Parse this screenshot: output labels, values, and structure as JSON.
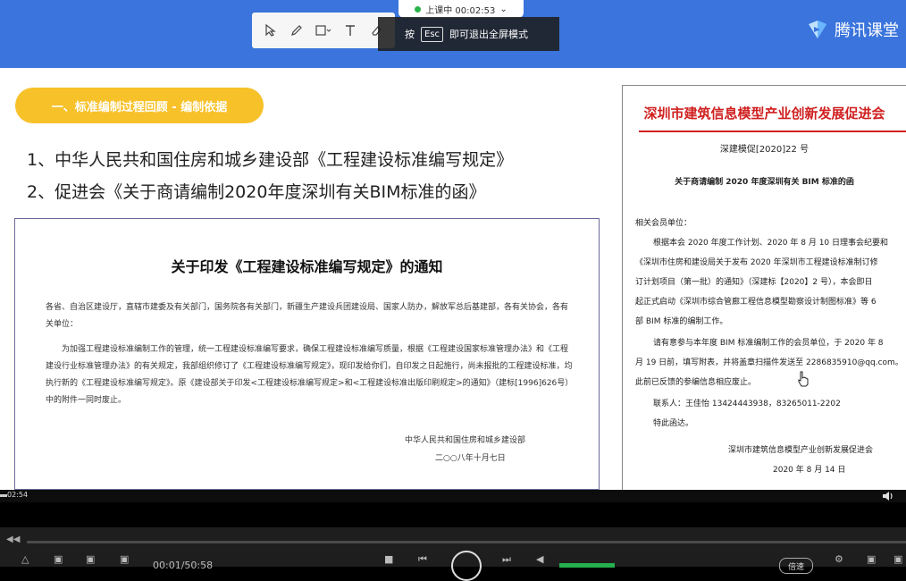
{
  "recording": {
    "status": "上课中 00:02:53",
    "dropdown": "⌄"
  },
  "esc_tip": {
    "prefix": "按",
    "key": "Esc",
    "suffix": "即可退出全屏模式"
  },
  "brand": {
    "name": "腾讯课堂"
  },
  "toolbar": {
    "tools": [
      "pointer-tool",
      "pen-tool",
      "shape-tool",
      "text-tool",
      "eraser-tool"
    ]
  },
  "slide": {
    "section_title": "一、标准编制过程回顾 - 编制依据",
    "basis": [
      "1、中华人民共和国住房和城乡建设部《工程建设标准编写规定》",
      "2、促进会《关于商请编制2020年度深圳有关BIM标准的函》"
    ],
    "doc1": {
      "title": "关于印发《工程建设标准编写规定》的通知",
      "p1": "各省、自治区建设厅，直辖市建委及有关部门，国务院各有关部门，新疆生产建设兵团建设局、国家人防办，解放军总后基建部，各有关协会，各有关单位：",
      "p2": "为加强工程建设标准编制工作的管理，统一工程建设标准编写要求，确保工程建设标准编写质量，根据《工程建设国家标准管理办法》和《工程建设行业标准管理办法》的有关规定，我部组织修订了《工程建设标准编写规定》，现印发给你们，自印发之日起施行，尚未报批的工程建设标准，均执行新的《工程建设标准编写规定》。原《建设部关于印发<工程建设标准编写规定>和<工程建设标准出版印刷规定>的通知》（建标[1996]626号）中的附件一同时废止。",
      "sign_org": "中华人民共和国住房和城乡建设部",
      "sign_date": "二○○八年十月七日"
    },
    "doc2": {
      "org": "深圳市建筑信息模型产业创新发展促进会",
      "ref": "深建模促[2020]22 号",
      "title": "关于商请编制 2020 年度深圳有关 BIM 标准的函",
      "salutation": "相关会员单位：",
      "lines": [
        "根据本会 2020 年度工作计划、2020 年 8 月 10 日理事会纪要和",
        "《深圳市住房和建设局关于发布 2020 年深圳市工程建设标准制订修",
        "订计划项目（第一批）的通知》（深建标【2020】2 号），本会即日",
        "起正式启动《深圳市综合管廊工程信息模型勘察设计制图标准》等 6",
        "部 BIM 标准的编制工作。",
        "请有意参与本年度 BIM 标准编制工作的会员单位，于 2020 年 8",
        "月 19 日前，填写附表，并将盖章扫描件发送至 2286835910@qq.com。",
        "此前已反馈的参编信息相应废止。",
        "联系人：王佳怡 13424443938，83265011-2202",
        "特此函达。"
      ],
      "sign_org": "深圳市建筑信息模型产业创新发展促进会",
      "sign_date": "2020 年 8 月 14 日"
    }
  },
  "player": {
    "current_time": "02:54",
    "total_time": "00:01/50:58",
    "speed_label": "倍速",
    "volume_level": 1.0
  },
  "colors": {
    "topbar": "#3a74dc",
    "section_pill": "#f7c12a",
    "doc2_red": "#d02020",
    "volume_green": "#23b04d"
  }
}
